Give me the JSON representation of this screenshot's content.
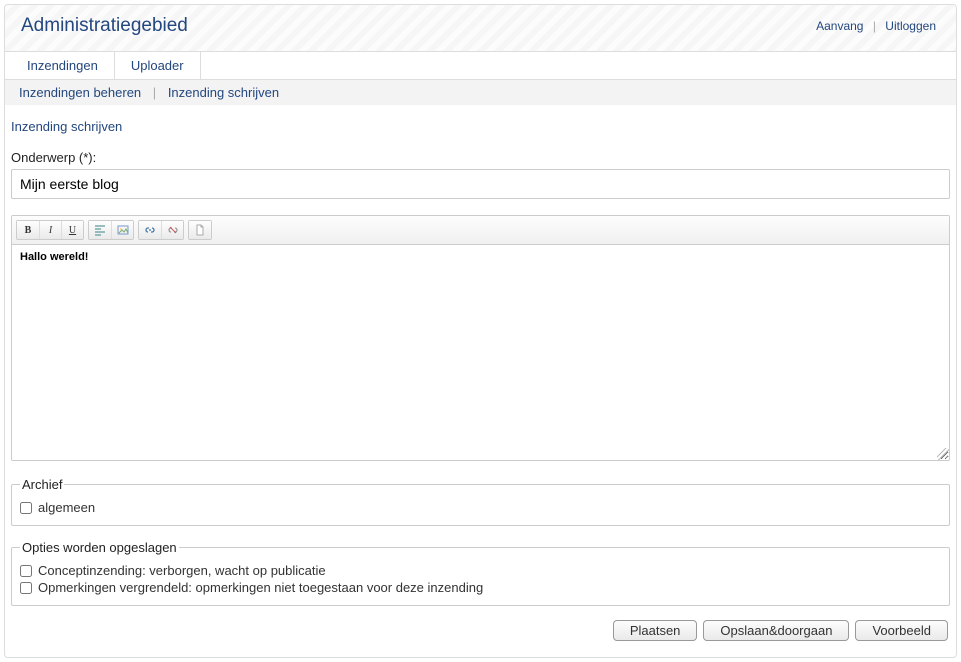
{
  "header": {
    "title": "Administratiegebied",
    "links": {
      "start": "Aanvang",
      "logout": "Uitloggen"
    }
  },
  "tabs": {
    "submissions": "Inzendingen",
    "uploader": "Uploader"
  },
  "subtabs": {
    "manage": "Inzendingen beheren",
    "write": "Inzending schrijven"
  },
  "page": {
    "heading": "Inzending schrijven",
    "subject_label": "Onderwerp (*):",
    "subject_value": "Mijn eerste blog"
  },
  "editor": {
    "content": "Hallo wereld!",
    "toolbar": {
      "bold": "B",
      "italic": "I",
      "underline": "U"
    }
  },
  "archive": {
    "legend": "Archief",
    "category": "algemeen"
  },
  "options": {
    "legend": "Opties worden opgeslagen",
    "draft": "Conceptinzending: verborgen, wacht op publicatie",
    "comments_locked": "Opmerkingen vergrendeld: opmerkingen niet toegestaan voor deze inzending"
  },
  "buttons": {
    "publish": "Plaatsen",
    "save_continue": "Opslaan&doorgaan",
    "preview": "Voorbeeld"
  }
}
